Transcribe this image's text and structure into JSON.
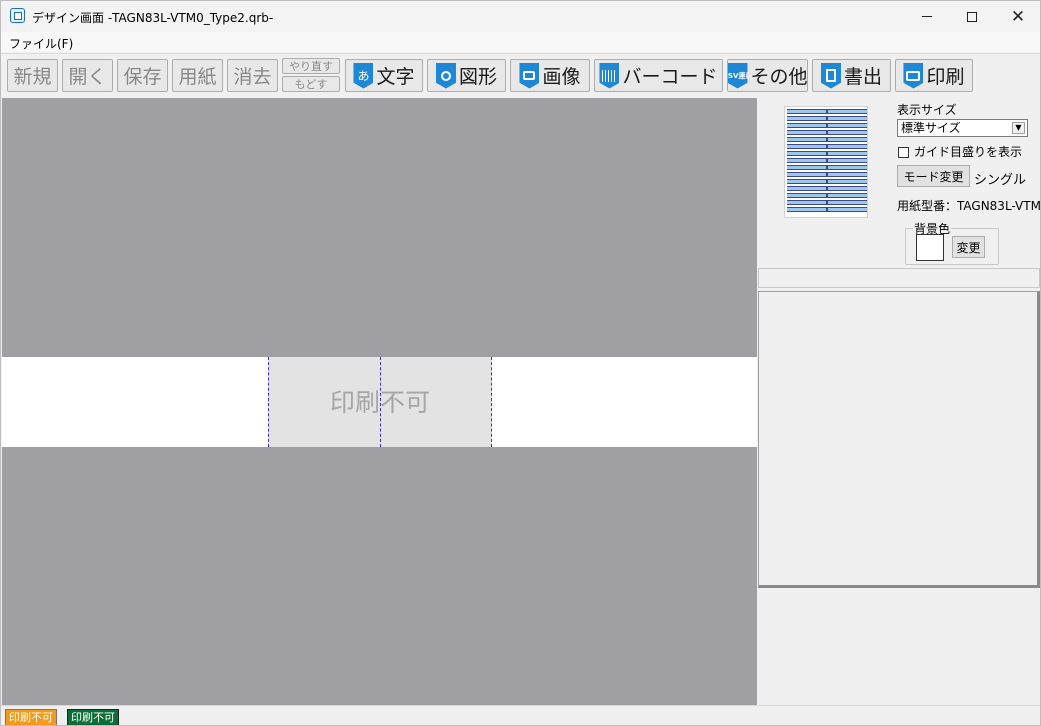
{
  "window": {
    "title": "デザイン画面 -TAGN83L-VTM0_Type2.qrb-",
    "minimize_glyph": "",
    "close_glyph": "✕"
  },
  "menu": {
    "file": "ファイル(F)"
  },
  "toolbar": {
    "new": "新規",
    "open": "開く",
    "save": "保存",
    "paper": "用紙",
    "erase": "消去",
    "redo": "やり直す",
    "undo": "もどす",
    "text": "文字",
    "text_icon": "あ",
    "shape": "図形",
    "image": "画像",
    "barcode": "バーコード",
    "other": "その他",
    "other_icon_line1": "CSV",
    "other_icon_line2": "連番",
    "export": "書出",
    "print": "印刷"
  },
  "canvas": {
    "no_print_text": "印刷不可",
    "background_color": "#a09fa4",
    "label_color": "#ffffff"
  },
  "right_panel": {
    "display_size_label": "表示サイズ",
    "display_size_value": "標準サイズ",
    "guide_label": "ガイド目盛りを表示",
    "guide_checked": false,
    "mode_change_button": "モード変更",
    "mode_value": "シングル",
    "paper_model": "用紙型番：TAGN83L-VTM",
    "bg_color_label": "背景色",
    "bg_change_button": "変更"
  },
  "status": {
    "badge_orange": "印刷不可",
    "badge_green": "印刷不可",
    "orange_color": "#f29a1a",
    "green_color": "#0b6e37"
  }
}
